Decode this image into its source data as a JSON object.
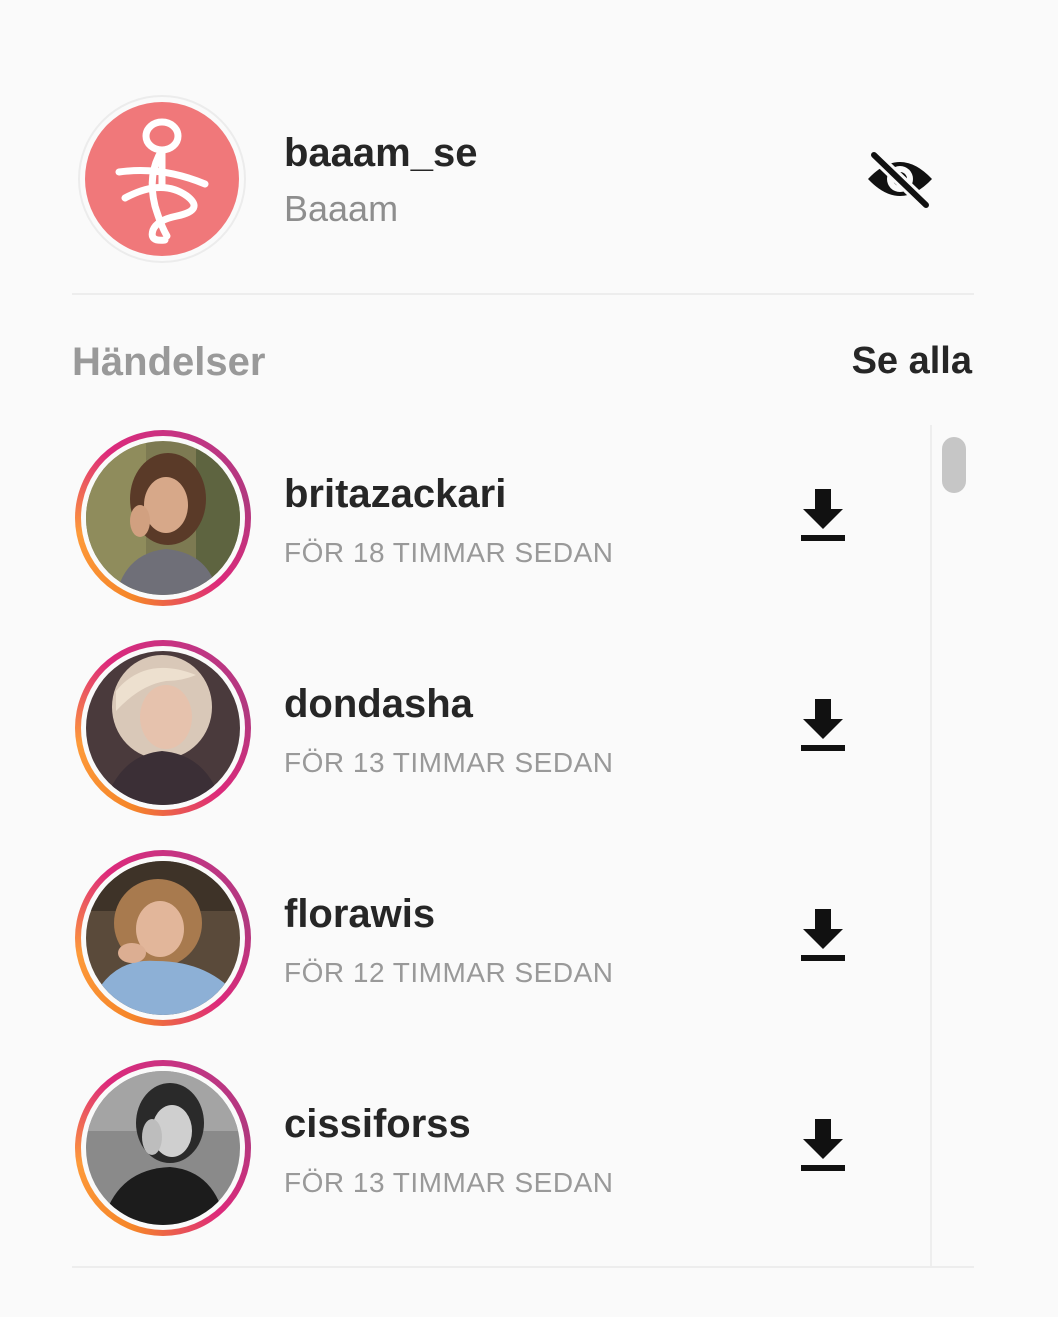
{
  "account": {
    "username": "baaam_se",
    "display_name": "Baaam",
    "avatar_color": "#f0787a",
    "avatar_icon": "baaam-logo-icon",
    "hide_icon": "eye-off-icon"
  },
  "section": {
    "title": "Händelser",
    "see_all_label": "Se alla"
  },
  "stories": [
    {
      "username": "britazackari",
      "time": "FÖR 18 TIMMAR SEDAN",
      "action_icon": "download-icon"
    },
    {
      "username": "dondasha",
      "time": "FÖR 13 TIMMAR SEDAN",
      "action_icon": "download-icon"
    },
    {
      "username": "florawis",
      "time": "FÖR 12 TIMMAR SEDAN",
      "action_icon": "download-icon"
    },
    {
      "username": "cissiforss",
      "time": "FÖR 13 TIMMAR SEDAN",
      "action_icon": "download-icon"
    }
  ],
  "colors": {
    "text_primary": "#262626",
    "text_secondary": "#999999",
    "story_ring_start": "#f58529",
    "story_ring_end": "#c13584",
    "background": "#fafafa"
  }
}
